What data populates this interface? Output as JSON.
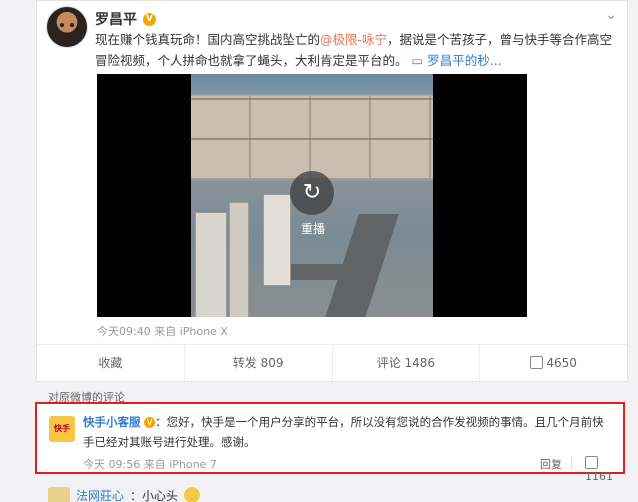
{
  "post": {
    "author": "罗昌平",
    "badge": "V",
    "text_before": "现在赚个钱真玩命！国内高空挑战坠亡的",
    "mention": "@极限-咏宁",
    "text_after": "，据说是个苦孩子，曾与快手等合作高空冒险视频，个人拼命也就拿了蝇头，大利肯定是平台的。",
    "video_link": "罗昌平的秒...",
    "replay_label": "重播",
    "meta": "今天09:40 来自 iPhone X",
    "actions": {
      "favorite": "收藏",
      "repost": "转发 809",
      "comment": "评论 1486",
      "like": "4650"
    }
  },
  "comments_header": "对原微博的评论",
  "comment": {
    "author": "快手小客服",
    "avatar_text": "快手",
    "text": "：您好，快手是一个用户分享的平台，所以没有您说的合作发视频的事情。且几个月前快手已经对其账号进行处理。感谢。",
    "meta": "今天 09:56 来自 iPhone 7",
    "reply": "回复",
    "likes": "1161"
  },
  "next_comment": {
    "author": "法网莊心",
    "text": "：小心头"
  },
  "colors": {
    "highlight_border": "#e11d1d",
    "link": "#2f7cce",
    "mention": "#eb7350"
  }
}
